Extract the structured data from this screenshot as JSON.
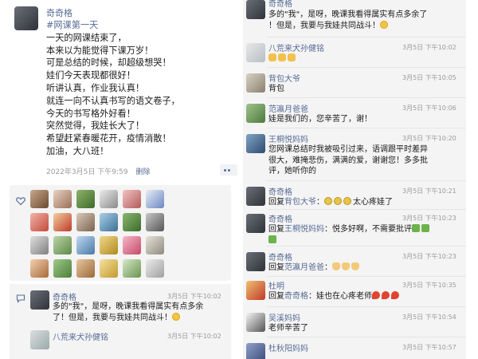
{
  "post": {
    "author": "奇奇格",
    "tag": "#网课第一天",
    "lines": [
      "一天的网课结束了，",
      "本来以为能觉得下课万岁！",
      "可是总结的时候，却超级想哭！",
      "娃们今天表现都很好！",
      "听讲认真，作业我认真！",
      "就连一向不认真书写的语文卷子，",
      "今天的书写格外好看！",
      "突然觉得，我娃长大了！",
      "希望赶紧春暖花开，疫情消散！",
      "加油，大八班！"
    ],
    "time": "2022年3月5日 下午9:59",
    "delete_label": "删除"
  },
  "left_comments": [
    {
      "name": "奇奇格",
      "time": "3月5日 下午10:02",
      "lines": [
        "多的\"我\"，是呀，晚课我看得属实有点多余",
        "了！但是，我要与我娃共同战斗！"
      ]
    },
    {
      "name": "八荒来犬孙健铭",
      "time": "3月5日 下午10:02",
      "lines": []
    }
  ],
  "right_comments": [
    {
      "name": "奇奇格",
      "time": "",
      "lines": [
        "多的\"我\"，是呀，晚课我看得属实有点多余了",
        "！但是，我要与我娃共同战斗！"
      ]
    },
    {
      "name": "八荒来犬孙健铭",
      "time": "3月5日 下午10:02",
      "lines": [
        ""
      ]
    },
    {
      "name": "背包大爷",
      "time": "3月5日 下午10:05",
      "lines": [
        "背包"
      ]
    },
    {
      "name": "范瀛月爸爸",
      "time": "3月5日 下午10:06",
      "lines": [
        "娃是我们的，您辛苦了，谢！"
      ]
    },
    {
      "name": "王桐悦妈妈",
      "time": "3月5日 下午10:20",
      "lines": [
        "您网课总结时我被吸引过来，语调跟平时差异",
        "很大，难掩悲伤，满满的爱，谢谢您！多多批",
        "评，她听你的"
      ]
    },
    {
      "name": "奇奇格",
      "time": "3月5日 下午10:21",
      "reply_to": "背包大爷",
      "lines": [
        "太心疼娃了"
      ]
    },
    {
      "name": "奇奇格",
      "time": "3月5日 下午10:23",
      "reply_to": "王桐悦妈妈",
      "lines": [
        "悦多好啊，不需要批评",
        ""
      ]
    },
    {
      "name": "奇奇格",
      "time": "3月5日 下午10:23",
      "reply_to": "范瀛月爸爸",
      "lines": [
        ""
      ]
    },
    {
      "name": "杜明",
      "time": "3月5日 下午10:35",
      "reply_to": "奇奇格",
      "lines": [
        "娃也在心疼老师"
      ]
    },
    {
      "name": "吴溪妈妈",
      "time": "3月5日 下午10:54",
      "lines": [
        "老师辛苦了"
      ]
    },
    {
      "name": "杜秋阳妈妈",
      "time": "3月5日 下午10:57",
      "lines": []
    }
  ],
  "labels": {
    "reply_prefix": "回复",
    "colon": "："
  },
  "colors": {
    "link": "#576b95",
    "panel_bg": "#f4f4f4",
    "meta": "#9a9a9a"
  },
  "icons": [
    "heart-icon",
    "comment-bubble-icon",
    "more-dots-icon"
  ]
}
